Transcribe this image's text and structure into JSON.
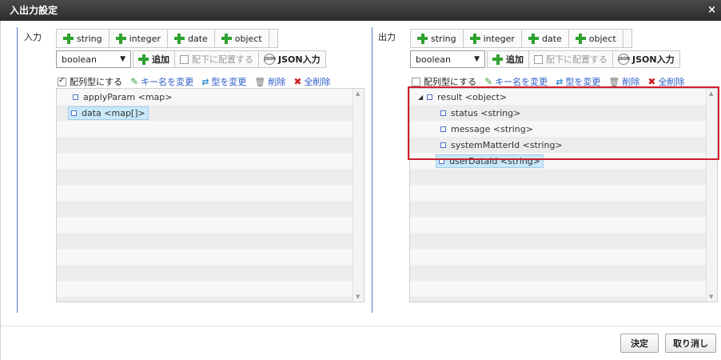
{
  "dialog": {
    "title": "入出力設定",
    "close": "×"
  },
  "left": {
    "label": "入力",
    "type_buttons": [
      "string",
      "integer",
      "date",
      "object"
    ],
    "select_value": "boolean",
    "add_label": "追加",
    "child_label": "配下に配置する",
    "json_label": "JSON入力",
    "array_label": "配列型にする",
    "array_checked": true,
    "rename_label": "キー名を変更",
    "retype_label": "型を変更",
    "delete_label": "削除",
    "delete_all_label": "全削除",
    "items": [
      "applyParam <map>",
      "data <map[]>"
    ]
  },
  "right": {
    "label": "出力",
    "type_buttons": [
      "string",
      "integer",
      "date",
      "object"
    ],
    "select_value": "boolean",
    "add_label": "追加",
    "child_label": "配下に配置する",
    "json_label": "JSON入力",
    "array_label": "配列型にする",
    "array_checked": false,
    "rename_label": "キー名を変更",
    "retype_label": "型を変更",
    "delete_label": "削除",
    "delete_all_label": "全削除",
    "root": "result <object>",
    "items": [
      "status <string>",
      "message <string>",
      "systemMatterId <string>",
      "userDataId <string>"
    ]
  },
  "footer": {
    "ok_label": "決定",
    "cancel_label": "取り消し"
  },
  "colors": {
    "highlight": "#d01f2a",
    "accent": "#2a5bc7",
    "add": "#2fa12f"
  }
}
